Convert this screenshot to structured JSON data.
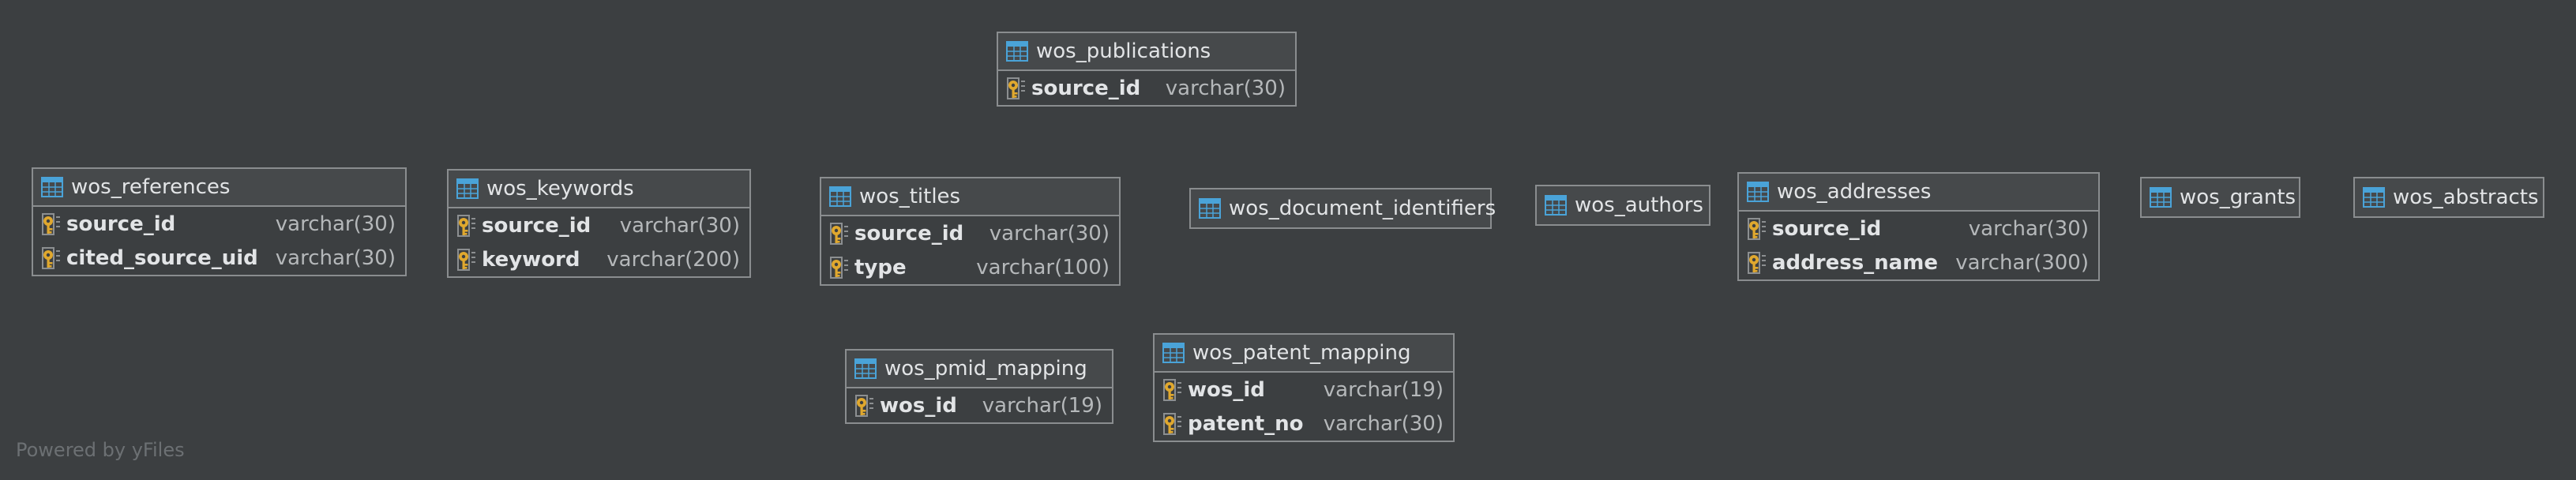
{
  "footer": "Powered by yFiles",
  "icons": {
    "table": "table-icon",
    "key": "primary-key-icon"
  },
  "colors": {
    "background": "#3c3f41",
    "border": "#8a8d8f",
    "header": "#46494b",
    "table_icon": "#4aa3d8",
    "key_icon": "#e0a82e"
  },
  "tables": {
    "publications": {
      "name": "wos_publications",
      "columns": [
        {
          "name": "source_id",
          "type": "varchar(30)"
        }
      ]
    },
    "references": {
      "name": "wos_references",
      "columns": [
        {
          "name": "source_id",
          "type": "varchar(30)"
        },
        {
          "name": "cited_source_uid",
          "type": "varchar(30)"
        }
      ]
    },
    "keywords": {
      "name": "wos_keywords",
      "columns": [
        {
          "name": "source_id",
          "type": "varchar(30)"
        },
        {
          "name": "keyword",
          "type": "varchar(200)"
        }
      ]
    },
    "titles": {
      "name": "wos_titles",
      "columns": [
        {
          "name": "source_id",
          "type": "varchar(30)"
        },
        {
          "name": "type",
          "type": "varchar(100)"
        }
      ]
    },
    "document_identifiers": {
      "name": "wos_document_identifiers",
      "columns": []
    },
    "authors": {
      "name": "wos_authors",
      "columns": []
    },
    "addresses": {
      "name": "wos_addresses",
      "columns": [
        {
          "name": "source_id",
          "type": "varchar(30)"
        },
        {
          "name": "address_name",
          "type": "varchar(300)"
        }
      ]
    },
    "grants": {
      "name": "wos_grants",
      "columns": []
    },
    "abstracts": {
      "name": "wos_abstracts",
      "columns": []
    },
    "pmid_mapping": {
      "name": "wos_pmid_mapping",
      "columns": [
        {
          "name": "wos_id",
          "type": "varchar(19)"
        }
      ]
    },
    "patent_mapping": {
      "name": "wos_patent_mapping",
      "columns": [
        {
          "name": "wos_id",
          "type": "varchar(19)"
        },
        {
          "name": "patent_no",
          "type": "varchar(30)"
        }
      ]
    }
  }
}
